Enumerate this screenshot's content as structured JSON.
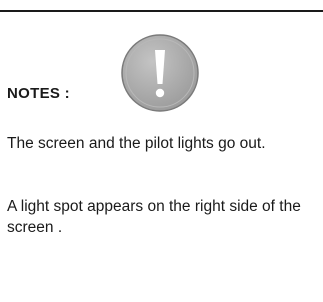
{
  "notes": {
    "label": "NOTES :",
    "paragraphs": [
      "The screen and the pilot lights go out.",
      "A light spot appears on the right side of the screen ."
    ]
  },
  "icon": {
    "name": "exclamation-icon",
    "fill": "#a6a6a6",
    "stroke": "#7a7a7a",
    "glyph_color": "#ffffff"
  }
}
